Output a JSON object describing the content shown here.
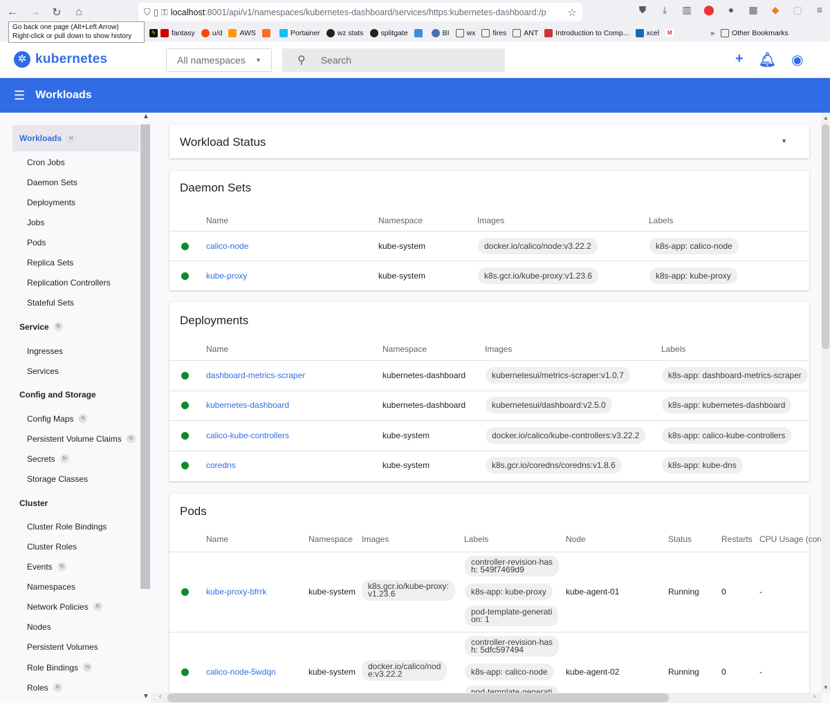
{
  "browser": {
    "url_host": "localhost",
    "url_rest": ":8001/api/v1/namespaces/kubernetes-dashboard/services/https:kubernetes-dashboard:/p",
    "tooltip_line1": "Go back one page (Alt+Left Arrow)",
    "tooltip_line2": "Right-click or pull down to show history",
    "bookmarks": [
      "fantasy",
      "u/d",
      "AWS",
      "Portainer",
      "wz stats",
      "splitgate",
      "BI",
      "wx",
      "fires",
      "ANT",
      "Introduction to Comp...",
      "xcel"
    ],
    "other_bookmarks": "Other Bookmarks"
  },
  "header": {
    "app_name": "kubernetes",
    "namespace_select": "All namespaces",
    "search_placeholder": "Search"
  },
  "toolbar": {
    "title": "Workloads"
  },
  "sidebar": {
    "badge": "N",
    "items": [
      {
        "label": "Workloads",
        "kind": "act",
        "badge": true
      },
      {
        "label": "Cron Jobs",
        "kind": "sub"
      },
      {
        "label": "Daemon Sets",
        "kind": "sub"
      },
      {
        "label": "Deployments",
        "kind": "sub"
      },
      {
        "label": "Jobs",
        "kind": "sub"
      },
      {
        "label": "Pods",
        "kind": "sub"
      },
      {
        "label": "Replica Sets",
        "kind": "sub"
      },
      {
        "label": "Replication Controllers",
        "kind": "sub"
      },
      {
        "label": "Stateful Sets",
        "kind": "sub"
      },
      {
        "label": "Service",
        "kind": "sec",
        "badge": true
      },
      {
        "label": "Ingresses",
        "kind": "sub"
      },
      {
        "label": "Services",
        "kind": "sub"
      },
      {
        "label": "Config and Storage",
        "kind": "sec"
      },
      {
        "label": "Config Maps",
        "kind": "sub",
        "badge": true
      },
      {
        "label": "Persistent Volume Claims",
        "kind": "sub",
        "badge": true
      },
      {
        "label": "Secrets",
        "kind": "sub",
        "badge": true
      },
      {
        "label": "Storage Classes",
        "kind": "sub"
      },
      {
        "label": "Cluster",
        "kind": "sec"
      },
      {
        "label": "Cluster Role Bindings",
        "kind": "sub"
      },
      {
        "label": "Cluster Roles",
        "kind": "sub"
      },
      {
        "label": "Events",
        "kind": "sub",
        "badge": true
      },
      {
        "label": "Namespaces",
        "kind": "sub"
      },
      {
        "label": "Network Policies",
        "kind": "sub",
        "badge": true
      },
      {
        "label": "Nodes",
        "kind": "sub"
      },
      {
        "label": "Persistent Volumes",
        "kind": "sub"
      },
      {
        "label": "Role Bindings",
        "kind": "sub",
        "badge": true
      },
      {
        "label": "Roles",
        "kind": "sub",
        "badge": true
      }
    ]
  },
  "workload_status": {
    "title": "Workload Status"
  },
  "daemon_sets": {
    "title": "Daemon Sets",
    "columns": [
      "Name",
      "Namespace",
      "Images",
      "Labels"
    ],
    "rows": [
      {
        "name": "calico-node",
        "namespace": "kube-system",
        "image": "docker.io/calico/node:v3.22.2",
        "label": "k8s-app: calico-node"
      },
      {
        "name": "kube-proxy",
        "namespace": "kube-system",
        "image": "k8s.gcr.io/kube-proxy:v1.23.6",
        "label": "k8s-app: kube-proxy"
      }
    ]
  },
  "deployments": {
    "title": "Deployments",
    "columns": [
      "Name",
      "Namespace",
      "Images",
      "Labels"
    ],
    "rows": [
      {
        "name": "dashboard-metrics-scraper",
        "namespace": "kubernetes-dashboard",
        "image": "kubernetesui/metrics-scraper:v1.0.7",
        "label": "k8s-app: dashboard-metrics-scraper"
      },
      {
        "name": "kubernetes-dashboard",
        "namespace": "kubernetes-dashboard",
        "image": "kubernetesui/dashboard:v2.5.0",
        "label": "k8s-app: kubernetes-dashboard"
      },
      {
        "name": "calico-kube-controllers",
        "namespace": "kube-system",
        "image": "docker.io/calico/kube-controllers:v3.22.2",
        "label": "k8s-app: calico-kube-controllers"
      },
      {
        "name": "coredns",
        "namespace": "kube-system",
        "image": "k8s.gcr.io/coredns/coredns:v1.8.6",
        "label": "k8s-app: kube-dns"
      }
    ]
  },
  "pods": {
    "title": "Pods",
    "columns": [
      "Name",
      "Namespace",
      "Images",
      "Labels",
      "Node",
      "Status",
      "Restarts",
      "CPU Usage (core"
    ],
    "rows": [
      {
        "name": "kube-proxy-bfrrk",
        "namespace": "kube-system",
        "image_l1": "k8s.gcr.io/kube-proxy:",
        "image_l2": "v1.23.6",
        "label1_l1": "controller-revision-has",
        "label1_l2": "h: 549f7469d9",
        "label2": "k8s-app: kube-proxy",
        "label3_l1": "pod-template-generati",
        "label3_l2": "on: 1",
        "node": "kube-agent-01",
        "status": "Running",
        "restarts": "0",
        "cpu": "-"
      },
      {
        "name": "calico-node-5wdqn",
        "namespace": "kube-system",
        "image_l1": "docker.io/calico/nod",
        "image_l2": "e:v3.22.2",
        "label1_l1": "controller-revision-has",
        "label1_l2": "h: 5dfc597494",
        "label2": "k8s-app: calico-node",
        "label3_l1": "pod-template-generati",
        "label3_l2": "",
        "node": "kube-agent-02",
        "status": "Running",
        "restarts": "0",
        "cpu": "-"
      }
    ]
  }
}
